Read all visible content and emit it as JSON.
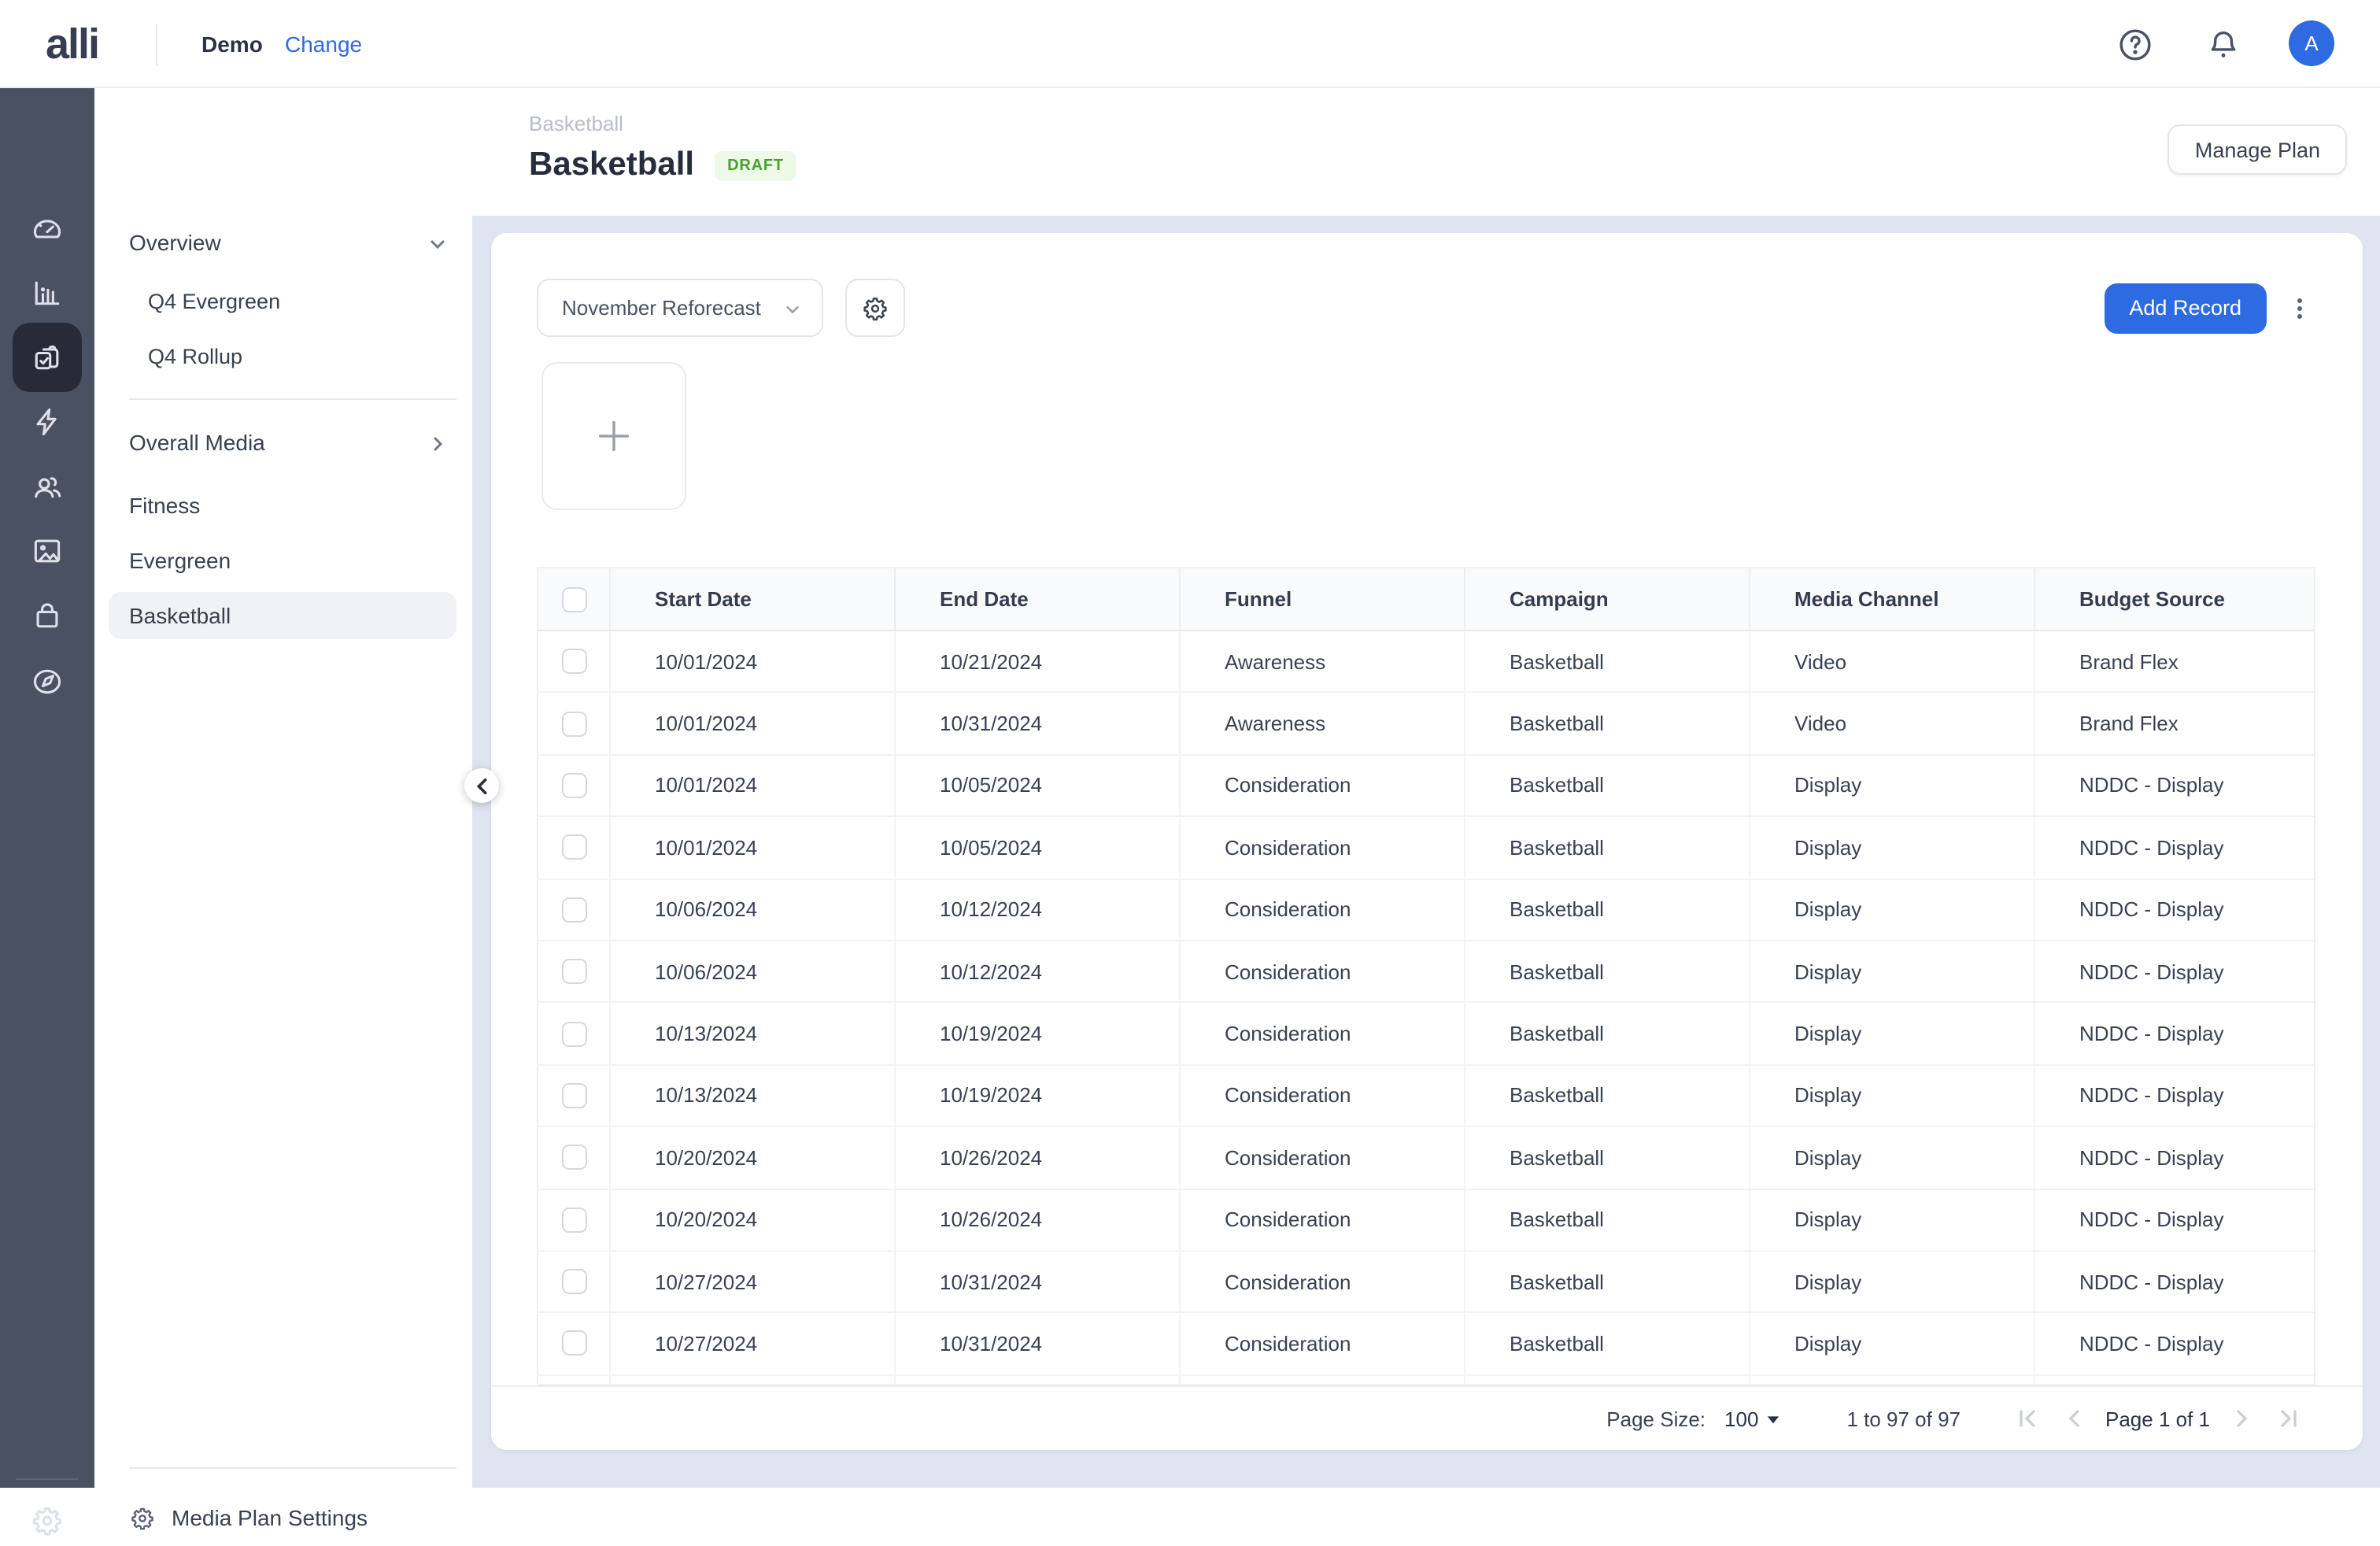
{
  "header": {
    "logo": "alli",
    "client": "Demo",
    "change_label": "Change",
    "avatar_initial": "A",
    "icons": [
      "help-icon",
      "notifications-bell-icon",
      "avatar"
    ]
  },
  "rail": {
    "icons": [
      "dashboard-gauge",
      "analytics-bar-chart",
      "media-plans-clipboard",
      "activation-lightning",
      "audiences-users",
      "creative-image",
      "commerce-bag",
      "explore-compass"
    ],
    "active": "media-plans-clipboard",
    "bottom_icon": "settings-gear"
  },
  "sidebar": {
    "items": [
      {
        "label": "Overview",
        "type": "group",
        "chevron": "down"
      },
      {
        "label": "Q4 Evergreen",
        "type": "child"
      },
      {
        "label": "Q4 Rollup",
        "type": "child"
      },
      {
        "label": "Overall Media",
        "type": "group",
        "chevron": "right"
      },
      {
        "label": "Fitness",
        "type": "item"
      },
      {
        "label": "Evergreen",
        "type": "item"
      },
      {
        "label": "Basketball",
        "type": "item",
        "selected": true
      }
    ],
    "settings_label": "Media Plan Settings"
  },
  "page": {
    "breadcrumb": "Basketball",
    "title": "Basketball",
    "status_badge": "DRAFT",
    "manage_button": "Manage Plan"
  },
  "toolbar": {
    "scenario_selector": "November Reforecast",
    "add_button": "Add Record"
  },
  "table": {
    "columns": [
      "Start Date",
      "End Date",
      "Funnel",
      "Campaign",
      "Media Channel",
      "Budget Source"
    ],
    "rows": [
      [
        "10/01/2024",
        "10/21/2024",
        "Awareness",
        "Basketball",
        "Video",
        "Brand Flex"
      ],
      [
        "10/01/2024",
        "10/31/2024",
        "Awareness",
        "Basketball",
        "Video",
        "Brand Flex"
      ],
      [
        "10/01/2024",
        "10/05/2024",
        "Consideration",
        "Basketball",
        "Display",
        "NDDC - Display"
      ],
      [
        "10/01/2024",
        "10/05/2024",
        "Consideration",
        "Basketball",
        "Display",
        "NDDC - Display"
      ],
      [
        "10/06/2024",
        "10/12/2024",
        "Consideration",
        "Basketball",
        "Display",
        "NDDC - Display"
      ],
      [
        "10/06/2024",
        "10/12/2024",
        "Consideration",
        "Basketball",
        "Display",
        "NDDC - Display"
      ],
      [
        "10/13/2024",
        "10/19/2024",
        "Consideration",
        "Basketball",
        "Display",
        "NDDC - Display"
      ],
      [
        "10/13/2024",
        "10/19/2024",
        "Consideration",
        "Basketball",
        "Display",
        "NDDC - Display"
      ],
      [
        "10/20/2024",
        "10/26/2024",
        "Consideration",
        "Basketball",
        "Display",
        "NDDC - Display"
      ],
      [
        "10/20/2024",
        "10/26/2024",
        "Consideration",
        "Basketball",
        "Display",
        "NDDC - Display"
      ],
      [
        "10/27/2024",
        "10/31/2024",
        "Consideration",
        "Basketball",
        "Display",
        "NDDC - Display"
      ],
      [
        "10/27/2024",
        "10/31/2024",
        "Consideration",
        "Basketball",
        "Display",
        "NDDC - Display"
      ]
    ]
  },
  "pagination": {
    "size_label": "Page Size:",
    "size_value": "100",
    "range": "1 to 97 of 97",
    "page_label": "Page 1 of 1"
  },
  "colors": {
    "accent_blue": "#2e6ae1",
    "canvas_background": "#e0e4f0",
    "rail_background": "#4a5163",
    "badge_background": "#eef9e7",
    "badge_text": "#47a12e",
    "selected_nav_background": "#f1f2f5"
  }
}
